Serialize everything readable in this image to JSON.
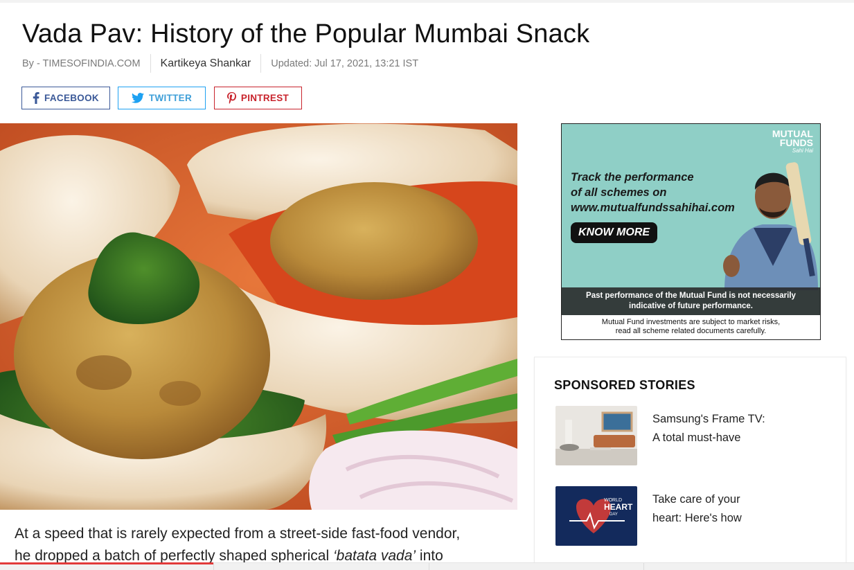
{
  "article": {
    "title": "Vada Pav: History of the Popular Mumbai Snack",
    "source": "By - TIMESOFINDIA.COM",
    "author": "Kartikeya Shankar",
    "updated": "Updated: Jul 17, 2021, 13:21 IST",
    "body_line1": "At a speed that is rarely expected from a street-side fast-food vendor,",
    "body_line2_start": "he dropped a batch of perfectly shaped spherical ",
    "body_line2_italic": "‘batata vada’",
    "body_line2_end": " into"
  },
  "share": {
    "facebook_label": "FACEBOOK",
    "twitter_label": "TWITTER",
    "pinterest_label": "PINTREST",
    "colors": {
      "facebook": "#3b5998",
      "twitter": "#1da1f2",
      "pinterest": "#c8232c"
    }
  },
  "ad": {
    "brand_line1": "MUTUAL",
    "brand_line2": "FUNDS",
    "brand_tag": "Sahi Hai",
    "headline_line1": "Track the performance",
    "headline_line2": "of all schemes on",
    "headline_line3": "www.mutualfundssahihai.com",
    "cta": "KNOW MORE",
    "disclaimer1_line1": "Past performance of the Mutual Fund is not necessarily",
    "disclaimer1_line2": "indicative of future performance.",
    "disclaimer2_line1": "Mutual Fund investments are subject to market risks,",
    "disclaimer2_line2": "read all scheme related documents carefully."
  },
  "sponsored": {
    "heading": "SPONSORED STORIES",
    "stories": [
      {
        "title": "Samsung's Frame TV: A total must-have"
      },
      {
        "title": "Take care of your heart: Here's how",
        "thumb_text_1": "WORLD",
        "thumb_text_2": "HEART",
        "thumb_text_3": "DAY"
      }
    ]
  },
  "reading_progress": 0.25
}
